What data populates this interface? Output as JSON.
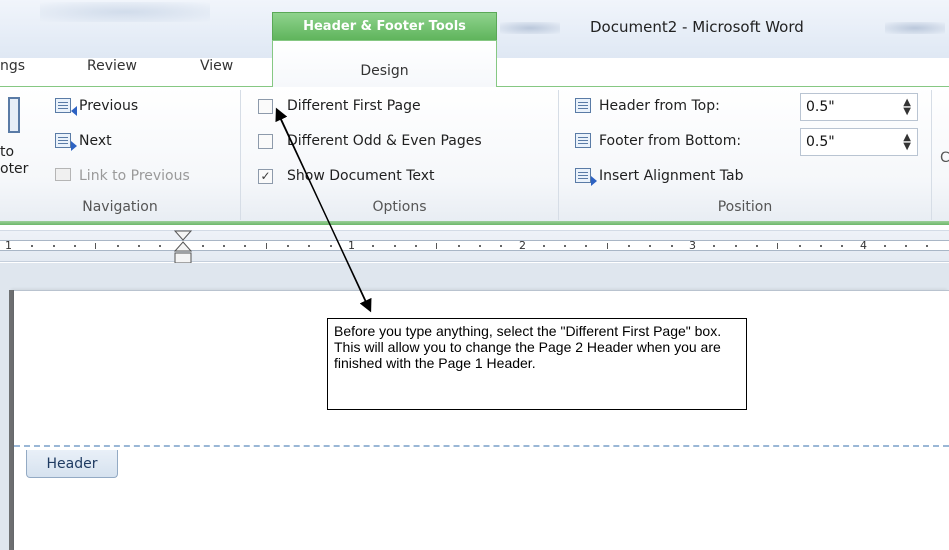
{
  "window": {
    "title": "Document2  -  Microsoft Word",
    "context_tab": "Header & Footer Tools"
  },
  "tabs": {
    "partial_left": "ngs",
    "review": "Review",
    "view": "View",
    "design": "Design"
  },
  "navigation": {
    "previous": "Previous",
    "next": "Next",
    "link_to_previous": "Link to Previous",
    "goto_line1": "to",
    "goto_line2": "oter",
    "group_label": "Navigation"
  },
  "options": {
    "different_first_page": "Different First Page",
    "different_first_page_checked": false,
    "different_odd_even": "Different Odd & Even Pages",
    "different_odd_even_checked": false,
    "show_document_text": "Show Document Text",
    "show_document_text_checked": true,
    "group_label": "Options"
  },
  "position": {
    "header_from_top_label": "Header from Top:",
    "header_from_top_value": "0.5\"",
    "footer_from_bottom_label": "Footer from Bottom:",
    "footer_from_bottom_value": "0.5\"",
    "insert_alignment_tab": "Insert Alignment Tab",
    "group_label": "Position",
    "partial_right": "C"
  },
  "ruler": {
    "numbers": [
      "1",
      "1",
      "2",
      "3",
      "4"
    ]
  },
  "document": {
    "header_tag": "Header",
    "callout_text": "Before you type anything, select the \"Different First Page\" box. This will allow you to change the Page 2 Header when you are finished with the Page 1 Header."
  },
  "colors": {
    "context_green": "#5fb45c",
    "ribbon_green": "#86c883",
    "header_dash": "#9ab7d6"
  }
}
